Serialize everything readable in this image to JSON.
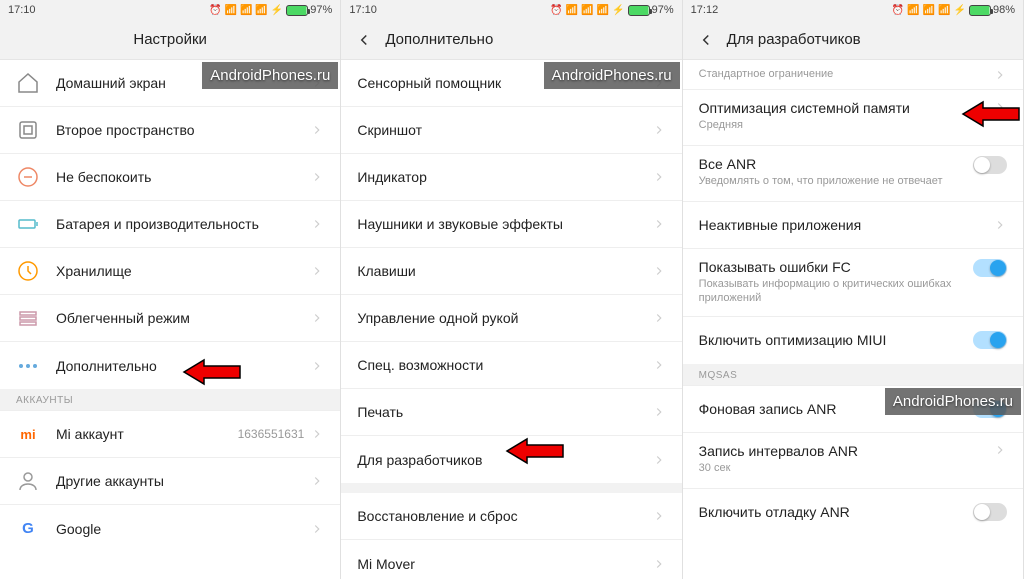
{
  "watermark": "AndroidPhones.ru",
  "screens": [
    {
      "time": "17:10",
      "battery": "97%",
      "title": "Настройки",
      "items": [
        {
          "label": "Домашний экран",
          "icon": "home"
        },
        {
          "label": "Второе пространство",
          "icon": "square"
        },
        {
          "label": "Не беспокоить",
          "icon": "dnd"
        },
        {
          "label": "Батарея и производительность",
          "icon": "battery"
        },
        {
          "label": "Хранилище",
          "icon": "storage"
        },
        {
          "label": "Облегченный режим",
          "icon": "lite"
        },
        {
          "label": "Дополнительно",
          "icon": "more"
        }
      ],
      "section": "АККАУНТЫ",
      "accounts": [
        {
          "label": "Mi аккаунт",
          "value": "1636551631",
          "icon": "mi"
        },
        {
          "label": "Другие аккаунты",
          "icon": "user"
        },
        {
          "label": "Google",
          "icon": "google"
        }
      ]
    },
    {
      "time": "17:10",
      "battery": "97%",
      "title": "Дополнительно",
      "items": [
        {
          "label": "Сенсорный помощник"
        },
        {
          "label": "Скриншот"
        },
        {
          "label": "Индикатор"
        },
        {
          "label": "Наушники и звуковые эффекты"
        },
        {
          "label": "Клавиши"
        },
        {
          "label": "Управление одной рукой"
        },
        {
          "label": "Спец. возможности"
        },
        {
          "label": "Печать"
        },
        {
          "label": "Для разработчиков"
        },
        {
          "label": "Восстановление и сброс"
        },
        {
          "label": "Mi Mover"
        }
      ]
    },
    {
      "time": "17:12",
      "battery": "98%",
      "title": "Для разработчиков",
      "items": [
        {
          "label": "",
          "sub": "Стандартное ограничение",
          "chev": true
        },
        {
          "label": "Оптимизация системной памяти",
          "sub": "Средняя",
          "chev": true
        },
        {
          "label": "Все ANR",
          "sub": "Уведомлять о том, что приложение не отвечает",
          "toggle": "off"
        },
        {
          "label": "Неактивные приложения",
          "chev": true
        },
        {
          "label": "Показывать ошибки FC",
          "sub": "Показывать информацию о критических ошибках приложений",
          "toggle": "on"
        },
        {
          "label": "Включить оптимизацию MIUI",
          "toggle": "on"
        }
      ],
      "section": "MQSAS",
      "items2": [
        {
          "label": "Фоновая запись ANR",
          "toggle": "on"
        },
        {
          "label": "Запись интервалов ANR",
          "sub": "30 сек",
          "chev": true
        },
        {
          "label": "Включить отладку ANR",
          "toggle": "off"
        }
      ]
    }
  ]
}
